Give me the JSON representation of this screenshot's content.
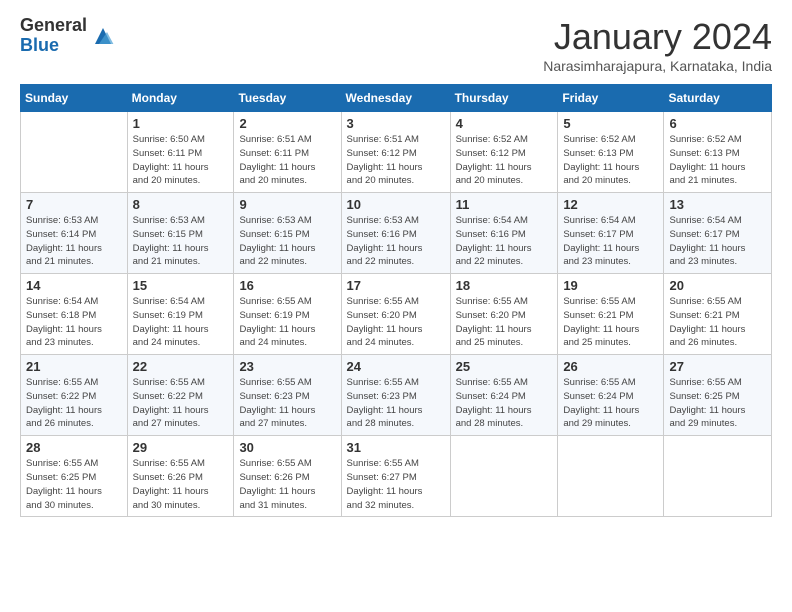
{
  "logo": {
    "general": "General",
    "blue": "Blue"
  },
  "title": "January 2024",
  "subtitle": "Narasimharajapura, Karnataka, India",
  "days_header": [
    "Sunday",
    "Monday",
    "Tuesday",
    "Wednesday",
    "Thursday",
    "Friday",
    "Saturday"
  ],
  "weeks": [
    [
      {
        "num": "",
        "detail": ""
      },
      {
        "num": "1",
        "detail": "Sunrise: 6:50 AM\nSunset: 6:11 PM\nDaylight: 11 hours\nand 20 minutes."
      },
      {
        "num": "2",
        "detail": "Sunrise: 6:51 AM\nSunset: 6:11 PM\nDaylight: 11 hours\nand 20 minutes."
      },
      {
        "num": "3",
        "detail": "Sunrise: 6:51 AM\nSunset: 6:12 PM\nDaylight: 11 hours\nand 20 minutes."
      },
      {
        "num": "4",
        "detail": "Sunrise: 6:52 AM\nSunset: 6:12 PM\nDaylight: 11 hours\nand 20 minutes."
      },
      {
        "num": "5",
        "detail": "Sunrise: 6:52 AM\nSunset: 6:13 PM\nDaylight: 11 hours\nand 20 minutes."
      },
      {
        "num": "6",
        "detail": "Sunrise: 6:52 AM\nSunset: 6:13 PM\nDaylight: 11 hours\nand 21 minutes."
      }
    ],
    [
      {
        "num": "7",
        "detail": "Sunrise: 6:53 AM\nSunset: 6:14 PM\nDaylight: 11 hours\nand 21 minutes."
      },
      {
        "num": "8",
        "detail": "Sunrise: 6:53 AM\nSunset: 6:15 PM\nDaylight: 11 hours\nand 21 minutes."
      },
      {
        "num": "9",
        "detail": "Sunrise: 6:53 AM\nSunset: 6:15 PM\nDaylight: 11 hours\nand 22 minutes."
      },
      {
        "num": "10",
        "detail": "Sunrise: 6:53 AM\nSunset: 6:16 PM\nDaylight: 11 hours\nand 22 minutes."
      },
      {
        "num": "11",
        "detail": "Sunrise: 6:54 AM\nSunset: 6:16 PM\nDaylight: 11 hours\nand 22 minutes."
      },
      {
        "num": "12",
        "detail": "Sunrise: 6:54 AM\nSunset: 6:17 PM\nDaylight: 11 hours\nand 23 minutes."
      },
      {
        "num": "13",
        "detail": "Sunrise: 6:54 AM\nSunset: 6:17 PM\nDaylight: 11 hours\nand 23 minutes."
      }
    ],
    [
      {
        "num": "14",
        "detail": "Sunrise: 6:54 AM\nSunset: 6:18 PM\nDaylight: 11 hours\nand 23 minutes."
      },
      {
        "num": "15",
        "detail": "Sunrise: 6:54 AM\nSunset: 6:19 PM\nDaylight: 11 hours\nand 24 minutes."
      },
      {
        "num": "16",
        "detail": "Sunrise: 6:55 AM\nSunset: 6:19 PM\nDaylight: 11 hours\nand 24 minutes."
      },
      {
        "num": "17",
        "detail": "Sunrise: 6:55 AM\nSunset: 6:20 PM\nDaylight: 11 hours\nand 24 minutes."
      },
      {
        "num": "18",
        "detail": "Sunrise: 6:55 AM\nSunset: 6:20 PM\nDaylight: 11 hours\nand 25 minutes."
      },
      {
        "num": "19",
        "detail": "Sunrise: 6:55 AM\nSunset: 6:21 PM\nDaylight: 11 hours\nand 25 minutes."
      },
      {
        "num": "20",
        "detail": "Sunrise: 6:55 AM\nSunset: 6:21 PM\nDaylight: 11 hours\nand 26 minutes."
      }
    ],
    [
      {
        "num": "21",
        "detail": "Sunrise: 6:55 AM\nSunset: 6:22 PM\nDaylight: 11 hours\nand 26 minutes."
      },
      {
        "num": "22",
        "detail": "Sunrise: 6:55 AM\nSunset: 6:22 PM\nDaylight: 11 hours\nand 27 minutes."
      },
      {
        "num": "23",
        "detail": "Sunrise: 6:55 AM\nSunset: 6:23 PM\nDaylight: 11 hours\nand 27 minutes."
      },
      {
        "num": "24",
        "detail": "Sunrise: 6:55 AM\nSunset: 6:23 PM\nDaylight: 11 hours\nand 28 minutes."
      },
      {
        "num": "25",
        "detail": "Sunrise: 6:55 AM\nSunset: 6:24 PM\nDaylight: 11 hours\nand 28 minutes."
      },
      {
        "num": "26",
        "detail": "Sunrise: 6:55 AM\nSunset: 6:24 PM\nDaylight: 11 hours\nand 29 minutes."
      },
      {
        "num": "27",
        "detail": "Sunrise: 6:55 AM\nSunset: 6:25 PM\nDaylight: 11 hours\nand 29 minutes."
      }
    ],
    [
      {
        "num": "28",
        "detail": "Sunrise: 6:55 AM\nSunset: 6:25 PM\nDaylight: 11 hours\nand 30 minutes."
      },
      {
        "num": "29",
        "detail": "Sunrise: 6:55 AM\nSunset: 6:26 PM\nDaylight: 11 hours\nand 30 minutes."
      },
      {
        "num": "30",
        "detail": "Sunrise: 6:55 AM\nSunset: 6:26 PM\nDaylight: 11 hours\nand 31 minutes."
      },
      {
        "num": "31",
        "detail": "Sunrise: 6:55 AM\nSunset: 6:27 PM\nDaylight: 11 hours\nand 32 minutes."
      },
      {
        "num": "",
        "detail": ""
      },
      {
        "num": "",
        "detail": ""
      },
      {
        "num": "",
        "detail": ""
      }
    ]
  ]
}
